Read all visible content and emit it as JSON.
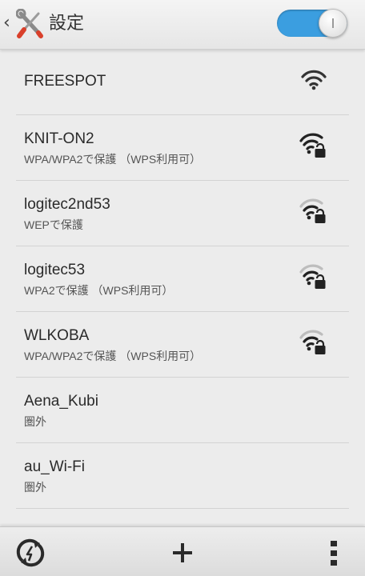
{
  "header": {
    "title": "設定",
    "wifi_toggle": "on",
    "accent": "#3b9ee0"
  },
  "networks": [
    {
      "ssid": "FREESPOT",
      "status": "",
      "signal": "strong",
      "locked": false
    },
    {
      "ssid": "KNIT-ON2",
      "status": "WPA/WPA2で保護 （WPS利用可）",
      "signal": "strong",
      "locked": true
    },
    {
      "ssid": "logitec2nd53",
      "status": "WEPで保護",
      "signal": "weak",
      "locked": true
    },
    {
      "ssid": "logitec53",
      "status": "WPA2で保護 （WPS利用可）",
      "signal": "weak",
      "locked": true
    },
    {
      "ssid": "WLKOBA",
      "status": "WPA/WPA2で保護 （WPS利用可）",
      "signal": "weak",
      "locked": true
    },
    {
      "ssid": "Aena_Kubi",
      "status": "圏外"
    },
    {
      "ssid": "au_Wi-Fi",
      "status": "圏外"
    }
  ],
  "bottom_bar": {
    "icons": [
      "scan-icon",
      "add-icon",
      "overflow-menu-icon"
    ]
  }
}
